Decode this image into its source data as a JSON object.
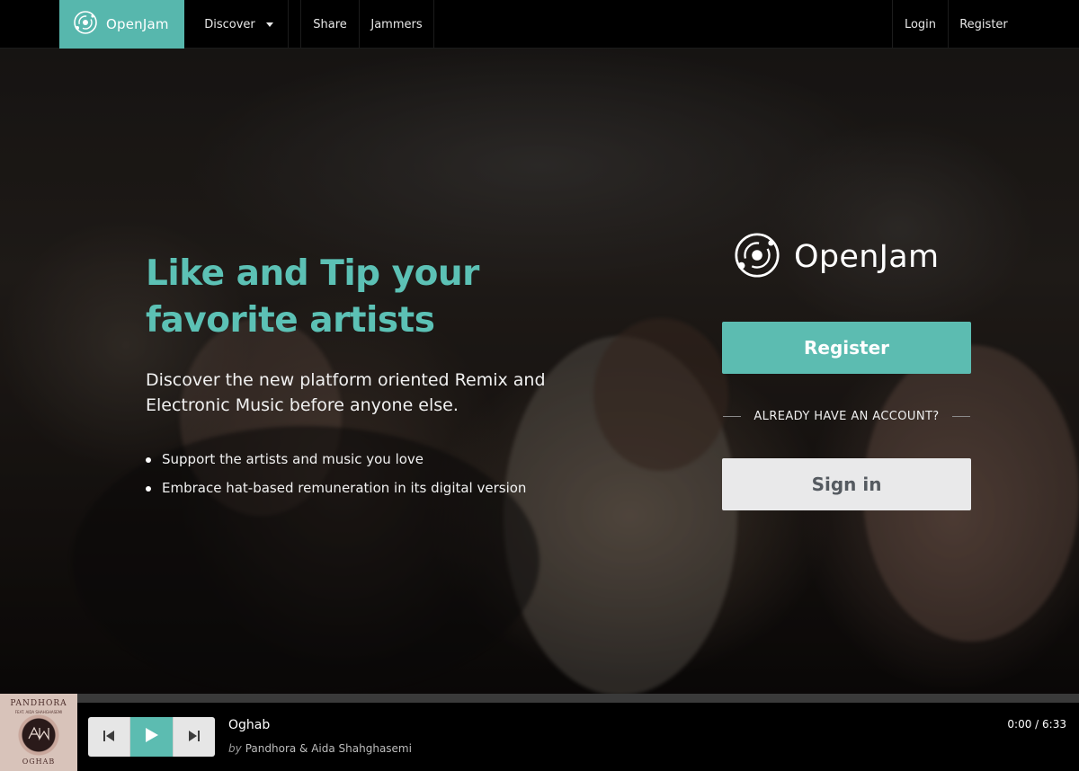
{
  "nav": {
    "brand": "OpenJam",
    "items": [
      {
        "label": "Discover",
        "has_dropdown": true
      },
      {
        "label": "Share"
      },
      {
        "label": "Jammers"
      }
    ],
    "right": [
      {
        "label": "Login"
      },
      {
        "label": "Register"
      }
    ]
  },
  "hero": {
    "headline": "Like and Tip your favorite artists",
    "subline": "Discover the new platform oriented Remix and Electronic Music before anyone else.",
    "bullets": [
      "Support the artists and music you love",
      "Embrace hat-based remuneration in its digital version"
    ]
  },
  "auth": {
    "logo_text": "OpenJam",
    "register_label": "Register",
    "divider_text": "ALREADY HAVE AN ACCOUNT?",
    "signin_label": "Sign in"
  },
  "player": {
    "cover_artist": "PANDHORA",
    "cover_feat": "FEAT. AIDA SHAHGHASEMI",
    "cover_title": "OGHAB",
    "track_title": "Oghab",
    "by_label": "by",
    "artists": "Pandhora & Aida Shahghasemi",
    "time": "0:00 / 6:33",
    "progress": 0
  },
  "colors": {
    "accent": "#5cbcb1",
    "nav_bg": "#000000",
    "signin_bg": "#e9e9ea"
  },
  "icons": [
    "openjam-logo-icon",
    "chevron-down-icon",
    "previous-icon",
    "play-icon",
    "next-icon"
  ]
}
